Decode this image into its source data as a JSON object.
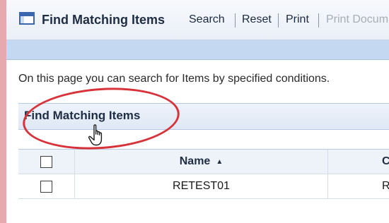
{
  "toolbar": {
    "title": "Find Matching Items",
    "buttons": [
      {
        "label": "Search",
        "enabled": true
      },
      {
        "label": "Reset",
        "enabled": true
      },
      {
        "label": "Print",
        "enabled": true
      },
      {
        "label": "Print Docum",
        "enabled": false
      }
    ]
  },
  "main": {
    "intro_text": "On this page you can search for Items by specified conditions.",
    "section_title": "Find Matching Items"
  },
  "grid": {
    "columns": [
      {
        "label": ""
      },
      {
        "label": "Name",
        "sort_icon": "sort-ascending-icon"
      },
      {
        "label": "C"
      }
    ],
    "rows": [
      {
        "name": "RETEST01",
        "next": "RE"
      }
    ]
  },
  "colors": {
    "highlight": "#d6333b",
    "accent": "#3a67ad",
    "subbar": "#c5d8f2"
  }
}
